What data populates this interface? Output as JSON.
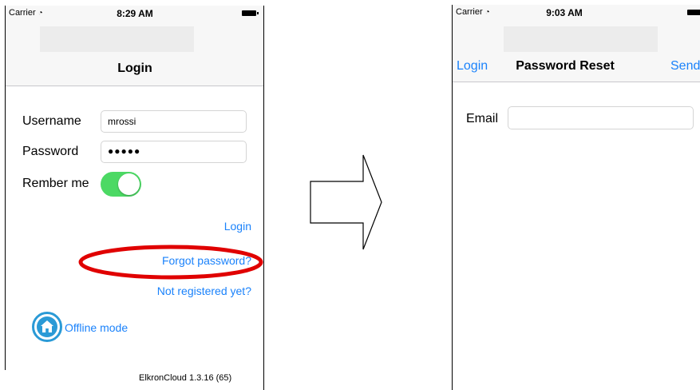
{
  "login_screen": {
    "status": {
      "carrier": "Carrier",
      "wifi_icon": "wifi-icon",
      "time": "8:29 AM"
    },
    "title": "Login",
    "username": {
      "label": "Username",
      "value": "mrossi"
    },
    "password": {
      "label": "Password",
      "value": "●●●●●"
    },
    "remember": {
      "label": "Rember me",
      "enabled": true
    },
    "login_link": "Login",
    "forgot_link": "Forgot password?",
    "register_link": "Not registered yet?",
    "offline": {
      "label": "Offline mode",
      "icon": "home-icon"
    },
    "version": "ElkronCloud 1.3.16 (65)",
    "highlight_color": "#e00000"
  },
  "reset_screen": {
    "status": {
      "carrier": "Carrier",
      "wifi_icon": "wifi-icon",
      "time": "9:03 AM"
    },
    "back_label": "Login",
    "title": "Password Reset",
    "send_label": "Send",
    "email": {
      "label": "Email",
      "value": ""
    }
  },
  "colors": {
    "ios_blue": "#1a82fb",
    "toggle_on": "#4cd964",
    "offline_icon": "#2a9ad6"
  }
}
